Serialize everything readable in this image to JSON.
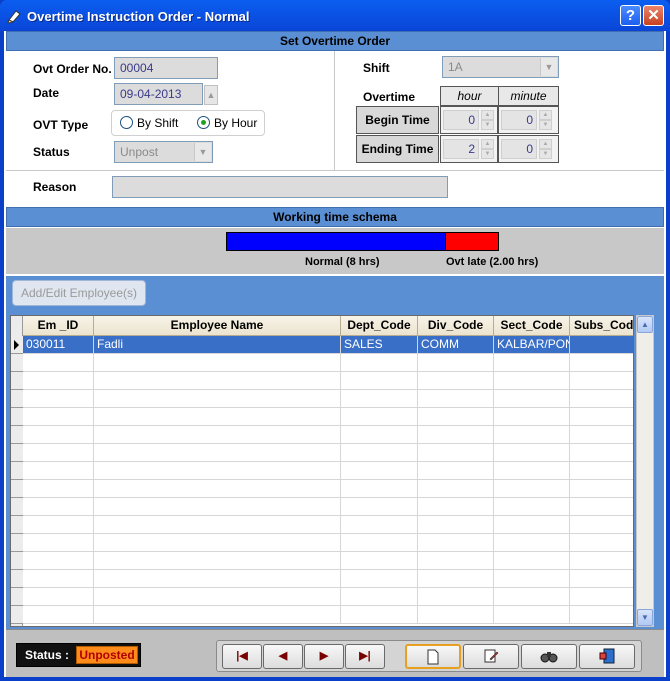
{
  "window": {
    "title": "Overtime Instruction Order - Normal",
    "help_glyph": "?",
    "close_glyph": "✕"
  },
  "section_order": {
    "title": "Set Overtime Order"
  },
  "form": {
    "ovt_order_label": "Ovt Order No.",
    "ovt_order_value": "00004",
    "date_label": "Date",
    "date_value": "09-04-2013",
    "ovt_type_label": "OVT Type",
    "ovt_type_options": [
      "By Shift",
      "By Hour"
    ],
    "ovt_type_selected": "By Hour",
    "status_label": "Status",
    "status_value": "Unpost",
    "shift_label": "Shift",
    "shift_value": "1A",
    "overtime_label": "Overtime",
    "hour_header": "hour",
    "minute_header": "minute",
    "begin_label": "Begin Time",
    "begin_hour": "0",
    "begin_minute": "0",
    "ending_label": "Ending Time",
    "ending_hour": "2",
    "ending_minute": "0",
    "reason_label": "Reason",
    "reason_value": ""
  },
  "section_schema": {
    "title": "Working time schema",
    "normal_label": "Normal  (8 hrs)",
    "ovt_label": "Ovt late  (2.00 hrs)",
    "colors": {
      "normal": "#0000ff",
      "overtime": "#ff0000"
    }
  },
  "toolbar": {
    "add_edit_label": "Add/Edit Employee(s)"
  },
  "table": {
    "columns": [
      "Em _ID",
      "Employee Name",
      "Dept_Code",
      "Div_Code",
      "Sect_Code",
      "Subs_Code"
    ],
    "rows": [
      [
        "030011",
        "Fadli",
        "SALES",
        "COMM",
        "KALBAR/PON",
        ""
      ]
    ]
  },
  "footer": {
    "status_label": "Status :",
    "status_value": "Unposted",
    "nav": {
      "first": "first-record",
      "prev": "previous-record",
      "next": "next-record",
      "last": "last-record"
    },
    "icons": [
      "new-document-icon",
      "edit-icon",
      "find-icon",
      "exit-icon"
    ]
  }
}
